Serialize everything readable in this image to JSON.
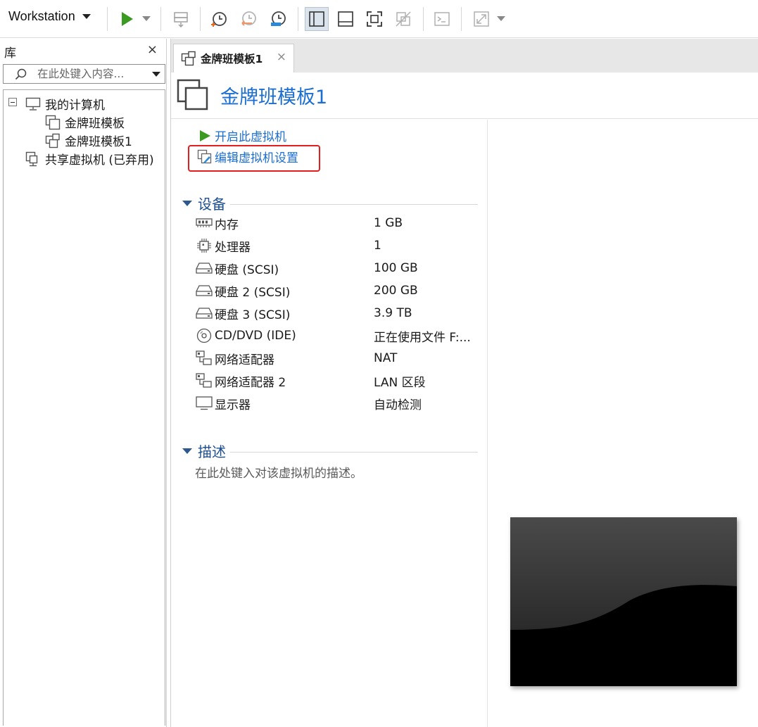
{
  "toolbar": {
    "workstation_label": "Workstation"
  },
  "library": {
    "title": "库",
    "close_glyph": "×",
    "search_placeholder": "在此处键入内容...",
    "tree": [
      {
        "label": "我的计算机",
        "icon": "computer-icon",
        "expanded": true
      },
      {
        "label": "金牌班模板",
        "icon": "vm-icon"
      },
      {
        "label": "金牌班模板1",
        "icon": "vm-open-icon"
      },
      {
        "label": "共享虚拟机 (已弃用)",
        "icon": "shared-vm-icon"
      }
    ]
  },
  "tab": {
    "label": "金牌班模板1",
    "close_glyph": "×"
  },
  "vm": {
    "title": "金牌班模板1",
    "actions": {
      "power_on": "开启此虚拟机",
      "edit_settings": "编辑虚拟机设置"
    },
    "devices_title": "设备",
    "devices": [
      {
        "name": "内存",
        "value": "1 GB",
        "icon": "memory-icon"
      },
      {
        "name": "处理器",
        "value": "1",
        "icon": "cpu-icon"
      },
      {
        "name": "硬盘 (SCSI)",
        "value": "100 GB",
        "icon": "hard-disk-icon"
      },
      {
        "name": "硬盘 2 (SCSI)",
        "value": "200 GB",
        "icon": "hard-disk-icon"
      },
      {
        "name": "硬盘 3 (SCSI)",
        "value": "3.9 TB",
        "icon": "hard-disk-icon"
      },
      {
        "name": "CD/DVD (IDE)",
        "value": "正在使用文件 F:...",
        "icon": "cd-dvd-icon"
      },
      {
        "name": "网络适配器",
        "value": "NAT",
        "icon": "network-adapter-icon"
      },
      {
        "name": "网络适配器 2",
        "value": "LAN 区段",
        "icon": "network-adapter-icon"
      },
      {
        "name": "显示器",
        "value": "自动检测",
        "icon": "display-icon"
      }
    ],
    "description_title": "描述",
    "description_placeholder": "在此处键入对该虚拟机的描述。"
  },
  "colors": {
    "accent_blue": "#1c6fd1",
    "section_blue": "#1d4f91",
    "play_green": "#3a9a22",
    "highlight_red": "#e41e1e"
  }
}
